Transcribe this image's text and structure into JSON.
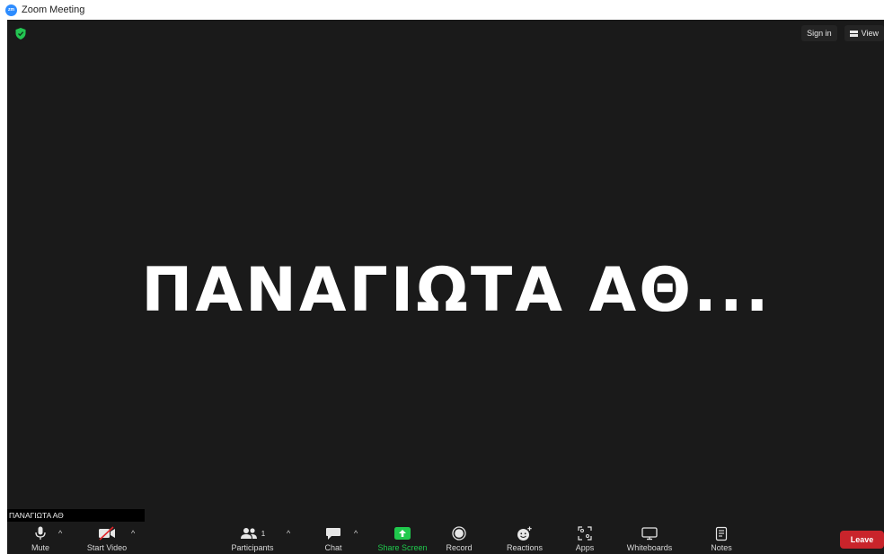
{
  "window": {
    "title": "Zoom Meeting",
    "logo_text": "zm"
  },
  "top_controls": {
    "sign_in": "Sign in",
    "view": "View"
  },
  "stage": {
    "participant_display": "ΠΑΝΑΓΙΩΤΑ ΑΘ...",
    "name_label": "ΠΑΝΑΓΙΩΤΑ ΑΘ"
  },
  "toolbar": {
    "mute": "Mute",
    "start_video": "Start Video",
    "participants": "Participants",
    "participants_count": "1",
    "chat": "Chat",
    "share_screen": "Share Screen",
    "record": "Record",
    "reactions": "Reactions",
    "apps": "Apps",
    "whiteboards": "Whiteboards",
    "notes": "Notes",
    "leave": "Leave"
  },
  "colors": {
    "accent_green": "#20c94d",
    "leave_red": "#c9242b",
    "zoom_blue": "#2D8CFF",
    "stage_bg": "#1a1a1a"
  }
}
